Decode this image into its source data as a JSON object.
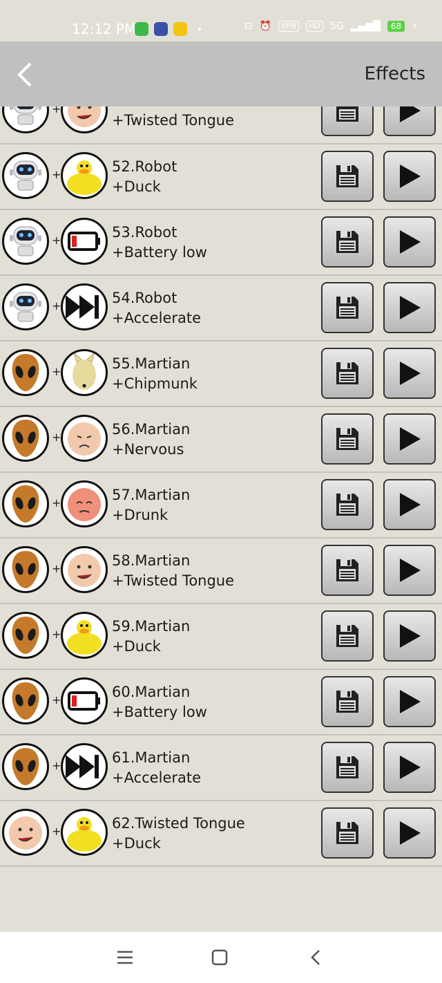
{
  "status_bar": {
    "time": "12:12 PM",
    "vpn": "VPN",
    "hd": "HD",
    "network": "5G",
    "battery": "68"
  },
  "header": {
    "title": "Effects"
  },
  "rows": [
    {
      "left_icon": "robot-icon",
      "right_icon": "twisted-tongue-face-icon",
      "name": "",
      "effect": "+Twisted Tongue"
    },
    {
      "left_icon": "robot-icon",
      "right_icon": "duck-icon",
      "name": "52.Robot",
      "effect": "+Duck"
    },
    {
      "left_icon": "robot-icon",
      "right_icon": "battery-low-icon",
      "name": "53.Robot",
      "effect": "+Battery low"
    },
    {
      "left_icon": "robot-icon",
      "right_icon": "fast-forward-icon",
      "name": "54.Robot",
      "effect": "+Accelerate"
    },
    {
      "left_icon": "martian-icon",
      "right_icon": "chipmunk-icon",
      "name": "55.Martian",
      "effect": "+Chipmunk"
    },
    {
      "left_icon": "martian-icon",
      "right_icon": "nervous-face-icon",
      "name": "56.Martian",
      "effect": "+Nervous"
    },
    {
      "left_icon": "martian-icon",
      "right_icon": "drunk-face-icon",
      "name": "57.Martian",
      "effect": "+Drunk"
    },
    {
      "left_icon": "martian-icon",
      "right_icon": "twisted-tongue-face-icon",
      "name": "58.Martian",
      "effect": "+Twisted Tongue"
    },
    {
      "left_icon": "martian-icon",
      "right_icon": "duck-icon",
      "name": "59.Martian",
      "effect": "+Duck"
    },
    {
      "left_icon": "martian-icon",
      "right_icon": "battery-low-icon",
      "name": "60.Martian",
      "effect": "+Battery low"
    },
    {
      "left_icon": "martian-icon",
      "right_icon": "fast-forward-icon",
      "name": "61.Martian",
      "effect": "+Accelerate"
    },
    {
      "left_icon": "twisted-tongue-face-icon",
      "right_icon": "duck-icon",
      "name": "62.Twisted Tongue",
      "effect": "+Duck"
    }
  ],
  "plus_sign": "+",
  "nav": {
    "items": [
      "menu-icon",
      "home-icon",
      "back-icon"
    ]
  }
}
